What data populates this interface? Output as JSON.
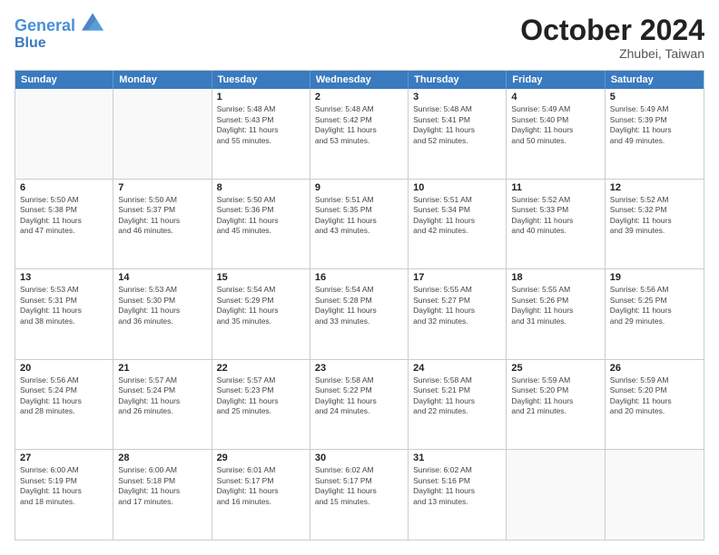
{
  "header": {
    "logo_line1": "General",
    "logo_line2": "Blue",
    "month": "October 2024",
    "location": "Zhubei, Taiwan"
  },
  "weekdays": [
    "Sunday",
    "Monday",
    "Tuesday",
    "Wednesday",
    "Thursday",
    "Friday",
    "Saturday"
  ],
  "weeks": [
    [
      {
        "day": "",
        "lines": []
      },
      {
        "day": "",
        "lines": []
      },
      {
        "day": "1",
        "lines": [
          "Sunrise: 5:48 AM",
          "Sunset: 5:43 PM",
          "Daylight: 11 hours",
          "and 55 minutes."
        ]
      },
      {
        "day": "2",
        "lines": [
          "Sunrise: 5:48 AM",
          "Sunset: 5:42 PM",
          "Daylight: 11 hours",
          "and 53 minutes."
        ]
      },
      {
        "day": "3",
        "lines": [
          "Sunrise: 5:48 AM",
          "Sunset: 5:41 PM",
          "Daylight: 11 hours",
          "and 52 minutes."
        ]
      },
      {
        "day": "4",
        "lines": [
          "Sunrise: 5:49 AM",
          "Sunset: 5:40 PM",
          "Daylight: 11 hours",
          "and 50 minutes."
        ]
      },
      {
        "day": "5",
        "lines": [
          "Sunrise: 5:49 AM",
          "Sunset: 5:39 PM",
          "Daylight: 11 hours",
          "and 49 minutes."
        ]
      }
    ],
    [
      {
        "day": "6",
        "lines": [
          "Sunrise: 5:50 AM",
          "Sunset: 5:38 PM",
          "Daylight: 11 hours",
          "and 47 minutes."
        ]
      },
      {
        "day": "7",
        "lines": [
          "Sunrise: 5:50 AM",
          "Sunset: 5:37 PM",
          "Daylight: 11 hours",
          "and 46 minutes."
        ]
      },
      {
        "day": "8",
        "lines": [
          "Sunrise: 5:50 AM",
          "Sunset: 5:36 PM",
          "Daylight: 11 hours",
          "and 45 minutes."
        ]
      },
      {
        "day": "9",
        "lines": [
          "Sunrise: 5:51 AM",
          "Sunset: 5:35 PM",
          "Daylight: 11 hours",
          "and 43 minutes."
        ]
      },
      {
        "day": "10",
        "lines": [
          "Sunrise: 5:51 AM",
          "Sunset: 5:34 PM",
          "Daylight: 11 hours",
          "and 42 minutes."
        ]
      },
      {
        "day": "11",
        "lines": [
          "Sunrise: 5:52 AM",
          "Sunset: 5:33 PM",
          "Daylight: 11 hours",
          "and 40 minutes."
        ]
      },
      {
        "day": "12",
        "lines": [
          "Sunrise: 5:52 AM",
          "Sunset: 5:32 PM",
          "Daylight: 11 hours",
          "and 39 minutes."
        ]
      }
    ],
    [
      {
        "day": "13",
        "lines": [
          "Sunrise: 5:53 AM",
          "Sunset: 5:31 PM",
          "Daylight: 11 hours",
          "and 38 minutes."
        ]
      },
      {
        "day": "14",
        "lines": [
          "Sunrise: 5:53 AM",
          "Sunset: 5:30 PM",
          "Daylight: 11 hours",
          "and 36 minutes."
        ]
      },
      {
        "day": "15",
        "lines": [
          "Sunrise: 5:54 AM",
          "Sunset: 5:29 PM",
          "Daylight: 11 hours",
          "and 35 minutes."
        ]
      },
      {
        "day": "16",
        "lines": [
          "Sunrise: 5:54 AM",
          "Sunset: 5:28 PM",
          "Daylight: 11 hours",
          "and 33 minutes."
        ]
      },
      {
        "day": "17",
        "lines": [
          "Sunrise: 5:55 AM",
          "Sunset: 5:27 PM",
          "Daylight: 11 hours",
          "and 32 minutes."
        ]
      },
      {
        "day": "18",
        "lines": [
          "Sunrise: 5:55 AM",
          "Sunset: 5:26 PM",
          "Daylight: 11 hours",
          "and 31 minutes."
        ]
      },
      {
        "day": "19",
        "lines": [
          "Sunrise: 5:56 AM",
          "Sunset: 5:25 PM",
          "Daylight: 11 hours",
          "and 29 minutes."
        ]
      }
    ],
    [
      {
        "day": "20",
        "lines": [
          "Sunrise: 5:56 AM",
          "Sunset: 5:24 PM",
          "Daylight: 11 hours",
          "and 28 minutes."
        ]
      },
      {
        "day": "21",
        "lines": [
          "Sunrise: 5:57 AM",
          "Sunset: 5:24 PM",
          "Daylight: 11 hours",
          "and 26 minutes."
        ]
      },
      {
        "day": "22",
        "lines": [
          "Sunrise: 5:57 AM",
          "Sunset: 5:23 PM",
          "Daylight: 11 hours",
          "and 25 minutes."
        ]
      },
      {
        "day": "23",
        "lines": [
          "Sunrise: 5:58 AM",
          "Sunset: 5:22 PM",
          "Daylight: 11 hours",
          "and 24 minutes."
        ]
      },
      {
        "day": "24",
        "lines": [
          "Sunrise: 5:58 AM",
          "Sunset: 5:21 PM",
          "Daylight: 11 hours",
          "and 22 minutes."
        ]
      },
      {
        "day": "25",
        "lines": [
          "Sunrise: 5:59 AM",
          "Sunset: 5:20 PM",
          "Daylight: 11 hours",
          "and 21 minutes."
        ]
      },
      {
        "day": "26",
        "lines": [
          "Sunrise: 5:59 AM",
          "Sunset: 5:20 PM",
          "Daylight: 11 hours",
          "and 20 minutes."
        ]
      }
    ],
    [
      {
        "day": "27",
        "lines": [
          "Sunrise: 6:00 AM",
          "Sunset: 5:19 PM",
          "Daylight: 11 hours",
          "and 18 minutes."
        ]
      },
      {
        "day": "28",
        "lines": [
          "Sunrise: 6:00 AM",
          "Sunset: 5:18 PM",
          "Daylight: 11 hours",
          "and 17 minutes."
        ]
      },
      {
        "day": "29",
        "lines": [
          "Sunrise: 6:01 AM",
          "Sunset: 5:17 PM",
          "Daylight: 11 hours",
          "and 16 minutes."
        ]
      },
      {
        "day": "30",
        "lines": [
          "Sunrise: 6:02 AM",
          "Sunset: 5:17 PM",
          "Daylight: 11 hours",
          "and 15 minutes."
        ]
      },
      {
        "day": "31",
        "lines": [
          "Sunrise: 6:02 AM",
          "Sunset: 5:16 PM",
          "Daylight: 11 hours",
          "and 13 minutes."
        ]
      },
      {
        "day": "",
        "lines": []
      },
      {
        "day": "",
        "lines": []
      }
    ]
  ]
}
